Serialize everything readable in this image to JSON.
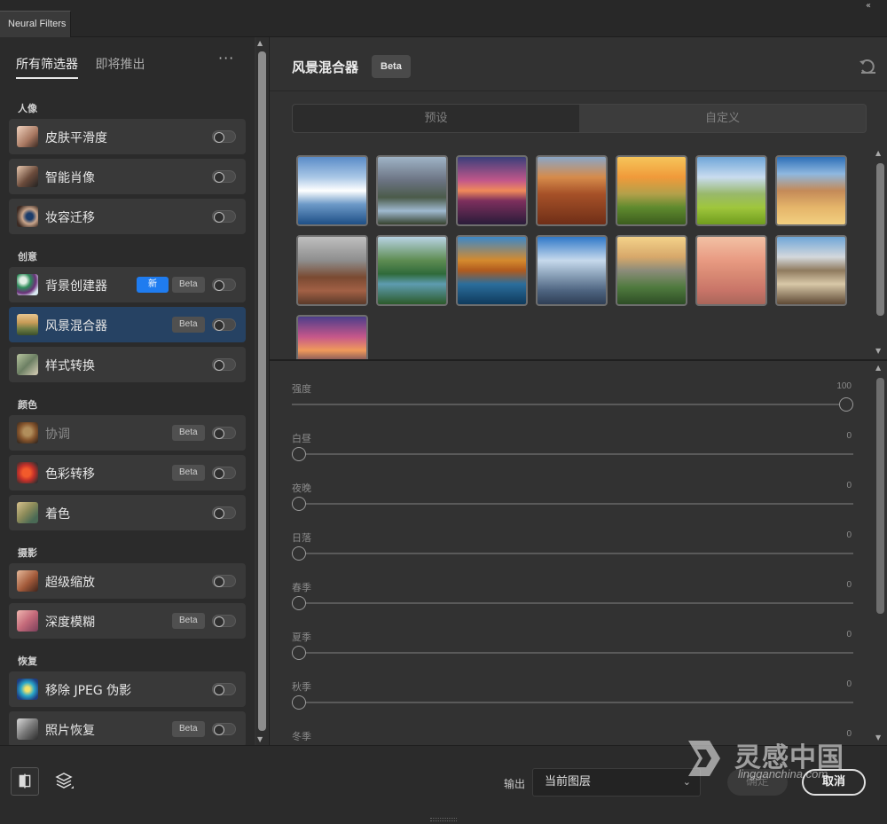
{
  "window": {
    "tab_title": "Neural Filters",
    "collapse_glyph": "‹‹"
  },
  "left_panel": {
    "tabs": [
      {
        "label": "所有筛选器",
        "active": true
      },
      {
        "label": "即将推出",
        "active": false
      }
    ],
    "more_label": "···",
    "categories": [
      {
        "label": "人像"
      },
      {
        "label": "创意"
      },
      {
        "label": "颜色"
      },
      {
        "label": "摄影"
      },
      {
        "label": "恢复"
      }
    ],
    "filters": [
      {
        "label": "皮肤平滑度",
        "category": "人像",
        "beta": false,
        "new": false,
        "selected": false,
        "enabled": false
      },
      {
        "label": "智能肖像",
        "category": "人像",
        "beta": false,
        "new": false,
        "selected": false,
        "enabled": false
      },
      {
        "label": "妆容迁移",
        "category": "人像",
        "beta": false,
        "new": false,
        "selected": false,
        "enabled": false
      },
      {
        "label": "背景创建器",
        "category": "创意",
        "beta": true,
        "new": true,
        "selected": false,
        "enabled": false
      },
      {
        "label": "风景混合器",
        "category": "创意",
        "beta": true,
        "new": false,
        "selected": true,
        "enabled": false
      },
      {
        "label": "样式转换",
        "category": "创意",
        "beta": false,
        "new": false,
        "selected": false,
        "enabled": false
      },
      {
        "label": "协调",
        "category": "颜色",
        "beta": true,
        "new": false,
        "selected": false,
        "enabled": false,
        "dimmed": true
      },
      {
        "label": "色彩转移",
        "category": "颜色",
        "beta": true,
        "new": false,
        "selected": false,
        "enabled": false
      },
      {
        "label": "着色",
        "category": "颜色",
        "beta": false,
        "new": false,
        "selected": false,
        "enabled": false
      },
      {
        "label": "超级缩放",
        "category": "摄影",
        "beta": false,
        "new": false,
        "selected": false,
        "enabled": false
      },
      {
        "label": "深度模糊",
        "category": "摄影",
        "beta": true,
        "new": false,
        "selected": false,
        "enabled": false
      },
      {
        "label": "移除 JPEG 伪影",
        "category": "恢复",
        "beta": false,
        "new": false,
        "selected": false,
        "enabled": false
      },
      {
        "label": "照片恢复",
        "category": "恢复",
        "beta": true,
        "new": false,
        "selected": false,
        "enabled": false
      }
    ],
    "badge_new": "新",
    "badge_beta": "Beta"
  },
  "right_panel": {
    "title": "风景混合器",
    "title_badge": "Beta",
    "segments": [
      {
        "label": "预设",
        "active": true
      },
      {
        "label": "自定义",
        "active": false
      }
    ],
    "presets": [
      {
        "name": "snowy-mountain-lake"
      },
      {
        "name": "mountain-valley-lake"
      },
      {
        "name": "sunset-matterhorn"
      },
      {
        "name": "grand-canyon"
      },
      {
        "name": "sunrise-hills"
      },
      {
        "name": "green-meadow"
      },
      {
        "name": "desert-cliffs"
      },
      {
        "name": "monument-valley"
      },
      {
        "name": "green-river-valley"
      },
      {
        "name": "autumn-lake"
      },
      {
        "name": "snow-peaks"
      },
      {
        "name": "yosemite"
      },
      {
        "name": "pink-misty-lake"
      },
      {
        "name": "rocky-coast"
      },
      {
        "name": "purple-sunset-mountains"
      }
    ],
    "sliders": [
      {
        "label": "强度",
        "value": 100,
        "max": 100
      },
      {
        "label": "白昼",
        "value": 0,
        "max": 100
      },
      {
        "label": "夜晚",
        "value": 0,
        "max": 100
      },
      {
        "label": "日落",
        "value": 0,
        "max": 100
      },
      {
        "label": "春季",
        "value": 0,
        "max": 100
      },
      {
        "label": "夏季",
        "value": 0,
        "max": 100
      },
      {
        "label": "秋季",
        "value": 0,
        "max": 100
      },
      {
        "label": "冬季",
        "value": 0,
        "max": 100
      }
    ]
  },
  "footer": {
    "output_label": "输出",
    "output_value": "当前图层",
    "ok_label": "确定",
    "cancel_label": "取消",
    "left_icons": [
      "compare-icon",
      "layers-icon"
    ]
  },
  "watermark": {
    "text": "灵感中国",
    "sub": "lingganchina.com"
  },
  "colors": {
    "accent_blue": "#1f7cf0",
    "selected_row": "#264263"
  }
}
